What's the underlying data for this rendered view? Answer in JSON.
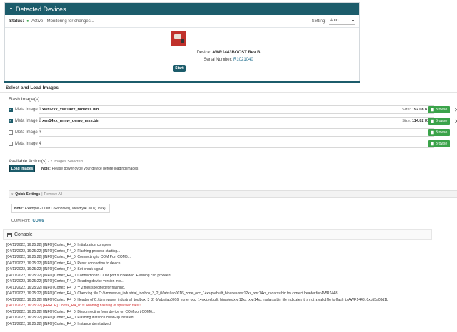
{
  "detected_devices": {
    "title": "Detected Devices",
    "status_label": "Status:",
    "status_value": "Active - Monitoring for changes...",
    "setting_label": "Setting:",
    "setting_value": "Auto",
    "device_label": "Device:",
    "device_value": "AWR1443BOOST Rev B",
    "serial_label": "Serial Number:",
    "serial_value": "R1021040",
    "start_label": "Start"
  },
  "select_load": {
    "title": "Select and Load Images",
    "flash_label": "Flash Image(s)",
    "size_label": "Size:",
    "browse_label": "Browse",
    "remove_glyph": "✕",
    "meta_images": [
      {
        "label": "Meta Image 1",
        "checked": true,
        "file": "xwr12xx_xwr14xx_radarss.bin",
        "size": "192.08 KB"
      },
      {
        "label": "Meta Image 2",
        "checked": true,
        "file": "xwr14xx_mmw_demo_mss.bin",
        "size": "114.82 KB"
      },
      {
        "label": "Meta Image 3",
        "checked": false,
        "file": "",
        "size": ""
      },
      {
        "label": "Meta Image 4",
        "checked": false,
        "file": "",
        "size": ""
      }
    ],
    "available_actions": "Available Action(s)",
    "images_selected": " - 2 Images Selected",
    "load_images_label": "Load Images",
    "note_label": "Note:",
    "note_text": "Please power cycle your device before loading images"
  },
  "quick_settings": {
    "title": "Quick Settings",
    "separator": "|",
    "remove_all": "Remove All",
    "note_label": "Note:",
    "note_text": "Example - COM1 (Windows), /dev/ttyACM0 (Linux)",
    "com_port_label": "COM Port:",
    "com_port_value": "COM6"
  },
  "console": {
    "title": "Console",
    "lines": [
      {
        "text": "[04/11/2022, 16:25:22] [INFO] Cortex_R4_0: Initialization complete",
        "error": false
      },
      {
        "text": "[04/11/2022, 16:25:22] [INFO] Cortex_R4_0: Flashing process starting...",
        "error": false
      },
      {
        "text": "[04/11/2022, 16:25:22] [INFO] Cortex_R4_0: Connecting to COM Port COM6...",
        "error": false
      },
      {
        "text": "[04/11/2022, 16:25:22] [INFO] Cortex_R4_0: Reset connection to device",
        "error": false
      },
      {
        "text": "[04/11/2022, 16:25:22] [INFO] Cortex_R4_0: Set break signal",
        "error": false
      },
      {
        "text": "[04/11/2022, 16:25:22] [INFO] Cortex_R4_0: Connection to COM port succeeded. Flashing can proceed.",
        "error": false
      },
      {
        "text": "[04/11/2022, 16:25:22] [INFO] Cortex_R4_0: Reading device version info...",
        "error": false
      },
      {
        "text": "[04/11/2022, 16:25:22] [INFO] Cortex_R4_0: ** 2 files specified for flashing.",
        "error": false
      },
      {
        "text": "[04/11/2022, 16:25:22] [INFO] Cortex_R4_0: Checking file C:/ti/mmwave_industrial_toolbox_3_2_0/labs/lab0016_zone_occ_14xx/prebuilt_binaries/xwr12xx_xwr14xx_radarss.bin for correct header for AWR1443.",
        "error": false
      },
      {
        "text": "[04/11/2022, 16:25:22] [INFO] Cortex_R4_0: Header of C:/ti/mmwave_industrial_toolbox_3_2_0/labs/lab0016_zone_occ_14xx/prebuilt_binaries/xwr12xx_xwr14xx_radarss.bin file indicates it is not a valid file to flash to AWR1443: 0xb55a03d1L",
        "error": false
      },
      {
        "text": "[04/11/2022, 16:25:22] [ERROR] Cortex_R4_0: !!! Aborting flashing of specified files!!!",
        "error": true
      },
      {
        "text": "[04/11/2022, 16:25:22] [INFO] Cortex_R4_0: Disconnecting from device on COM port COM6...",
        "error": false
      },
      {
        "text": "[04/11/2022, 16:25:22] [INFO] Cortex_R4_0: Flashing instance clean-up initiated...",
        "error": false
      },
      {
        "text": "[04/11/2022, 16:25:22] [INFO] Cortex_R4_0: Instance deinitialized!",
        "error": false
      }
    ]
  },
  "icons": {
    "caret": "▾",
    "check": "✓",
    "status_dot": "●",
    "folder": "▆"
  },
  "colors": {
    "header": "#1c5c6b",
    "browse": "#3ba34a",
    "error": "#d32f2f",
    "link": "#1c6c8c"
  }
}
